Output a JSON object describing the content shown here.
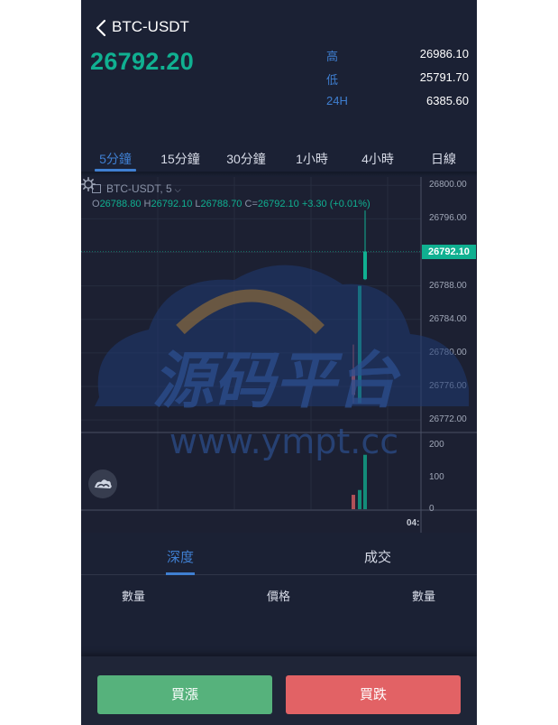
{
  "header": {
    "pair": "BTC-USDT",
    "last_price": "26792.20",
    "stats": [
      {
        "label": "高",
        "value": "26986.10"
      },
      {
        "label": "低",
        "value": "25791.70"
      },
      {
        "label": "24H",
        "value": "6385.60"
      }
    ]
  },
  "periods": {
    "active_index": 0,
    "items": [
      "5分鐘",
      "15分鐘",
      "30分鐘",
      "1小時",
      "4小時",
      "日線"
    ]
  },
  "chart": {
    "symbol_label": "BTC-USDT, 5",
    "ohlc": {
      "o_label": "O",
      "o": "26788.80",
      "h_label": "H",
      "h": "26792.10",
      "l_label": "L",
      "l": "26788.70",
      "c_label": "C=",
      "c": "26792.10",
      "change": "+3.30 (+0.01%)"
    },
    "current_price_tag": "26792.10",
    "price_axis": [
      "26800.00",
      "26796.00",
      "26792.10",
      "26788.00",
      "26784.00",
      "26780.00",
      "26776.00",
      "26772.00"
    ],
    "volume_axis": [
      "200",
      "100",
      "0"
    ],
    "time_label": "04:",
    "colors": {
      "up": "#10b091",
      "down": "#e26265",
      "bg": "#1c2032",
      "grid": "#262c3f"
    }
  },
  "chart_data": {
    "type": "candlestick",
    "ylim": [
      26770.5,
      26801.0
    ],
    "candles": [
      {
        "o": 26775.0,
        "h": 26781.0,
        "l": 26774.0,
        "c": 26778.0,
        "dir": "down"
      },
      {
        "o": 26774.0,
        "h": 26788.0,
        "l": 26774.0,
        "c": 26788.0,
        "dir": "up"
      },
      {
        "o": 26788.8,
        "h": 26797.0,
        "l": 26788.7,
        "c": 26792.1,
        "dir": "up"
      }
    ],
    "volume_ylim": [
      0,
      220
    ],
    "volume": [
      {
        "v": 45,
        "dir": "down"
      },
      {
        "v": 60,
        "dir": "up"
      },
      {
        "v": 170,
        "dir": "up"
      }
    ]
  },
  "depth": {
    "tabs": [
      "深度",
      "成交"
    ],
    "columns": [
      "數量",
      "價格",
      "數量"
    ]
  },
  "actions": {
    "buy": "買漲",
    "sell": "買跌"
  },
  "watermark": {
    "cn": "源码平台",
    "url": "www.ympt.cc"
  }
}
